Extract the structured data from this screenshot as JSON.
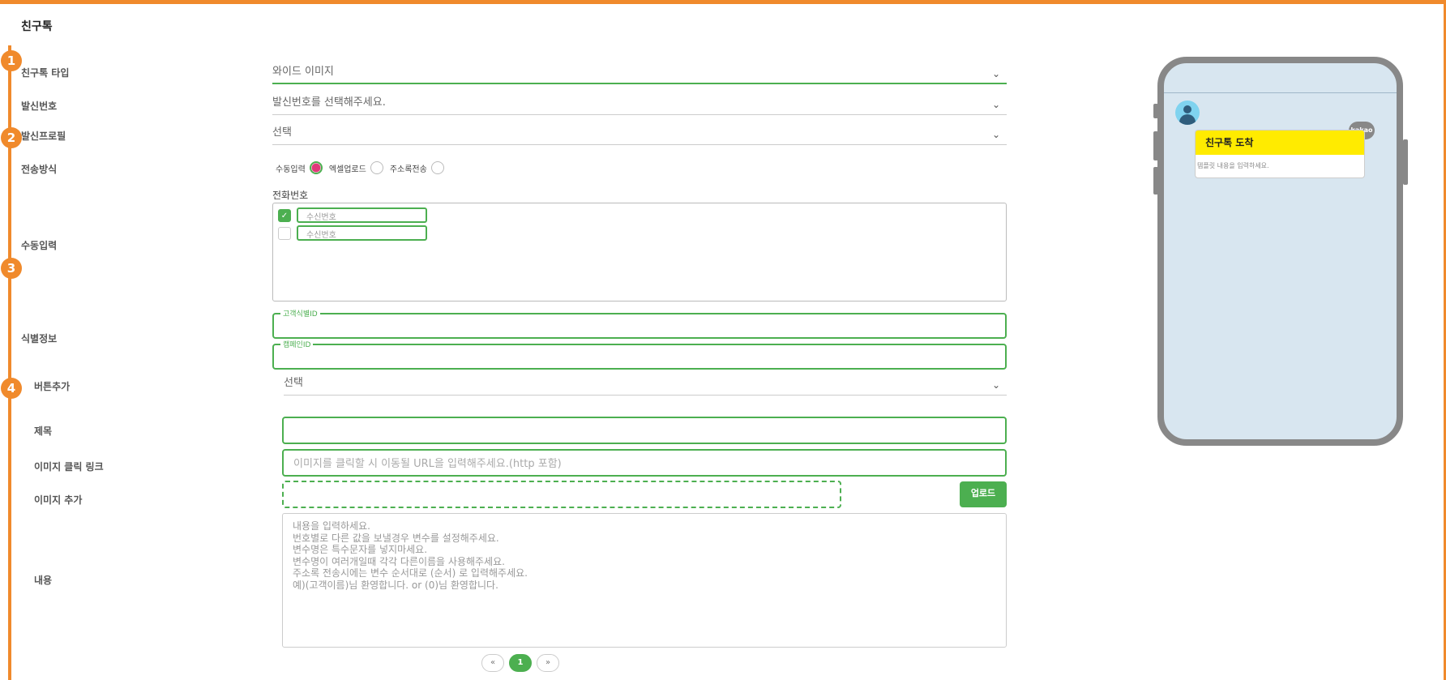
{
  "page": {
    "title": "친구톡"
  },
  "steps": [
    "1",
    "2",
    "3",
    "4"
  ],
  "labels": {
    "type": "친구톡 타입",
    "sender_number": "발신번호",
    "sender_profile": "발신프로필",
    "send_method": "전송방식",
    "manual_input": "수동입력",
    "id_info": "식별정보",
    "add_button": "버튼추가",
    "subject": "제목",
    "image_link": "이미지 클릭 링크",
    "add_image": "이미지 추가",
    "content": "내용"
  },
  "fields": {
    "type_value": "와이드 이미지",
    "sender_number_value": "발신번호를 선택해주세요.",
    "sender_profile_value": "선택",
    "button_value": "선택",
    "send_methods": [
      {
        "label": "수동입력",
        "checked": true
      },
      {
        "label": "엑셀업로드",
        "checked": false
      },
      {
        "label": "주소록전송",
        "checked": false
      }
    ],
    "phone_heading": "전화번호",
    "recipients": [
      {
        "placeholder": "수신번호",
        "checked": true
      },
      {
        "placeholder": "수신번호",
        "checked": false
      }
    ],
    "customer_id_legend": "고객식별ID",
    "campaign_id_legend": "캠페인ID",
    "image_link_placeholder": "이미지를 클릭할 시 이동될 URL을 입력해주세요.(http 포함)",
    "upload_label": "업로드",
    "content_placeholder": "내용을 입력하세요.\n번호별로 다른 값을 보낼경우 변수를 설정해주세요.\n변수명은 특수문자를 넣지마세요.\n변수명이 여러개일때 각각 다른이름을 사용해주세요.\n주소록 전송시에는 변수 순서대로 (순서) 로 입력해주세요.\n예)(고객이름)님 환영합니다. or (0)님 환영합니다."
  },
  "pagination": {
    "prev": "«",
    "current": "1",
    "next": "»"
  },
  "preview": {
    "badge": "kakao",
    "bubble_title": "친구톡 도착",
    "bubble_body": "템플릿 내용을 입력하세요."
  },
  "colors": {
    "accent": "#f08a2c",
    "active": "#4caf50",
    "bubble": "#ffeb00"
  }
}
